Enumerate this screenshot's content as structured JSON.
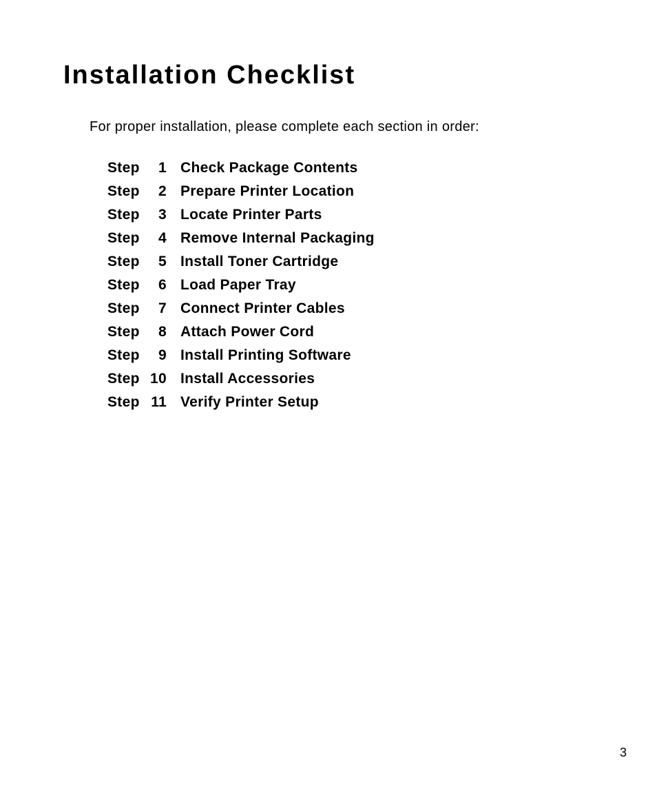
{
  "title": "Installation Checklist",
  "intro": "For proper installation, please complete each section in order:",
  "step_label": "Step",
  "steps": [
    {
      "n": "1",
      "title": "Check Package Contents"
    },
    {
      "n": "2",
      "title": "Prepare Printer Location"
    },
    {
      "n": "3",
      "title": "Locate Printer Parts"
    },
    {
      "n": "4",
      "title": "Remove Internal Packaging"
    },
    {
      "n": "5",
      "title": "Install Toner Cartridge"
    },
    {
      "n": "6",
      "title": "Load Paper Tray"
    },
    {
      "n": "7",
      "title": "Connect Printer Cables"
    },
    {
      "n": "8",
      "title": "Attach Power Cord"
    },
    {
      "n": "9",
      "title": "Install Printing Software"
    },
    {
      "n": "10",
      "title": "Install Accessories"
    },
    {
      "n": "11",
      "title": "Verify Printer Setup"
    }
  ],
  "page_number": "3"
}
